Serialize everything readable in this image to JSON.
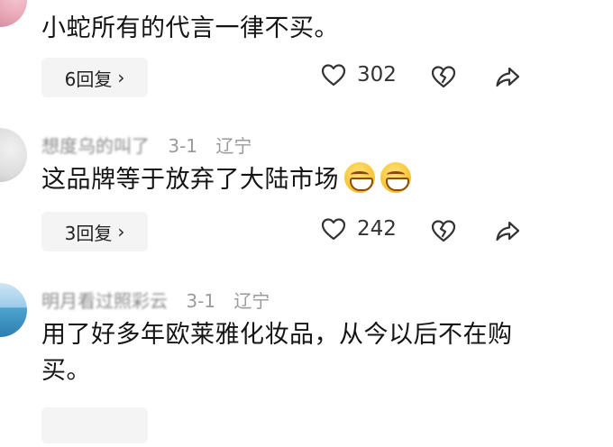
{
  "comments": [
    {
      "name": "",
      "date": "",
      "location": "",
      "text": "小蛇所有的代言一律不买。",
      "reply_label": "6回复",
      "likes": "302",
      "emoji_count": 0
    },
    {
      "name": "想度乌的叫了",
      "date": "3-1",
      "location": "辽宁",
      "text": "这品牌等于放弃了大陆市场",
      "reply_label": "3回复",
      "likes": "242",
      "emoji_count": 2
    },
    {
      "name": "明月看过照彩云",
      "date": "3-1",
      "location": "辽宁",
      "text": "用了好多年欧莱雅化妆品，从今以后不在购买。",
      "reply_label": "",
      "likes": "",
      "emoji_count": 0
    }
  ],
  "icons": {
    "reply_chevron": "chevron-right-icon",
    "like": "heart-outline-icon",
    "dislike": "broken-heart-icon",
    "share": "share-arrow-icon"
  }
}
